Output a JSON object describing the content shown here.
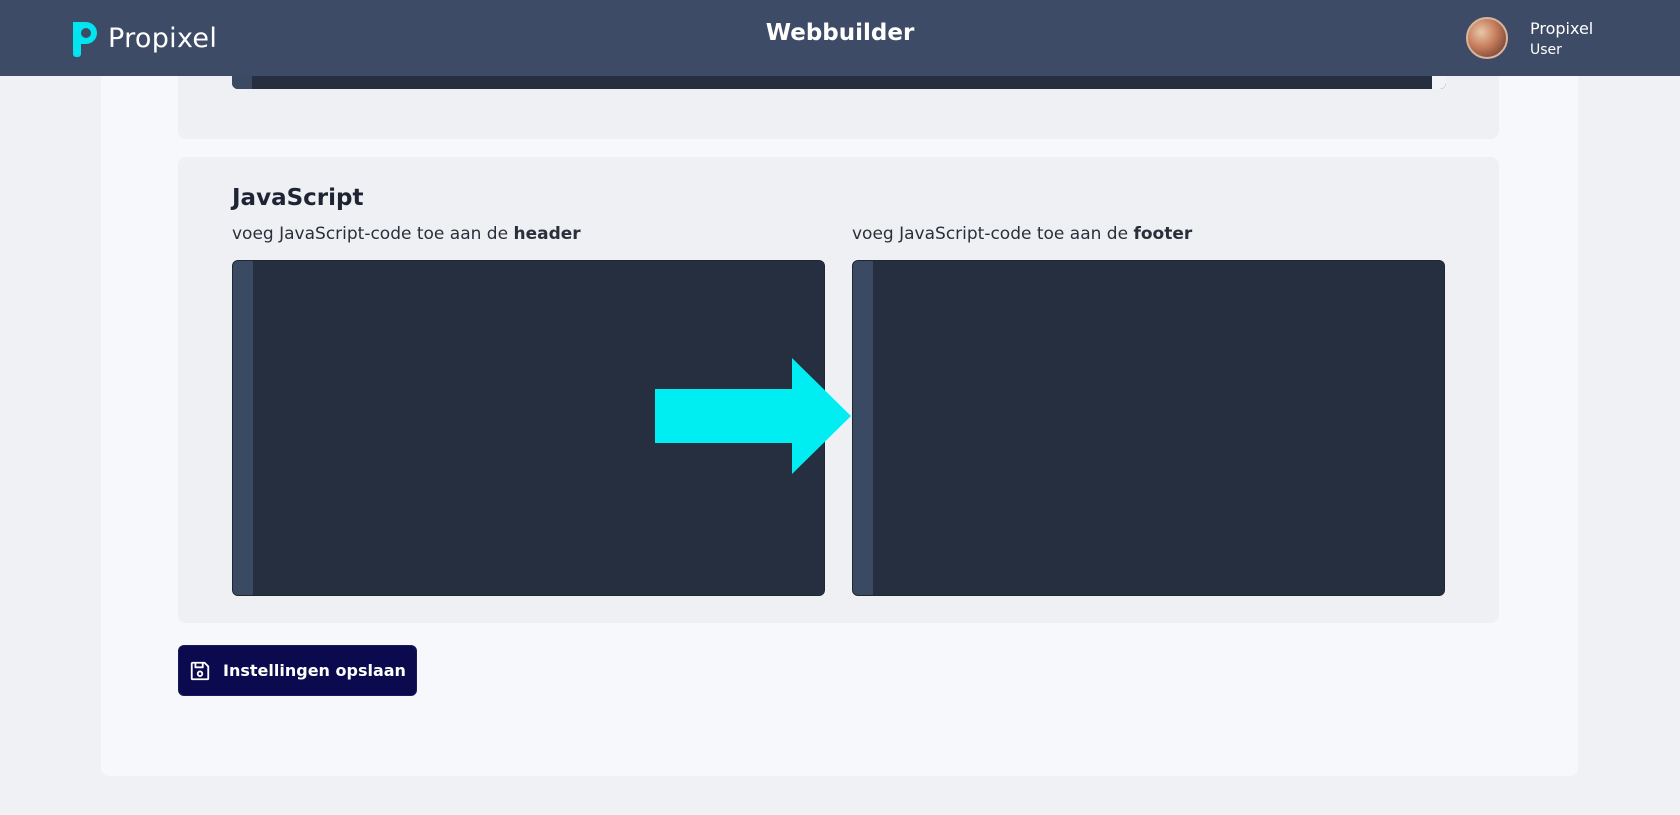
{
  "header": {
    "brand": "Propixel",
    "title": "Webbuilder",
    "user": {
      "name": "Propixel",
      "role": "User"
    }
  },
  "javascript_section": {
    "title": "JavaScript",
    "header_field": {
      "label_prefix": "voeg JavaScript-code toe aan de ",
      "label_bold": "header",
      "value": ""
    },
    "footer_field": {
      "label_prefix": "voeg JavaScript-code toe aan de ",
      "label_bold": "footer",
      "value": ""
    }
  },
  "actions": {
    "save_label": "Instellingen opslaan"
  },
  "colors": {
    "topbar": "#3e4b66",
    "brand_accent": "#00e5f0",
    "editor_bg": "#262f3f",
    "editor_gutter": "#3b4a63",
    "save_button": "#0b0a4f",
    "arrow": "#00eef2"
  }
}
